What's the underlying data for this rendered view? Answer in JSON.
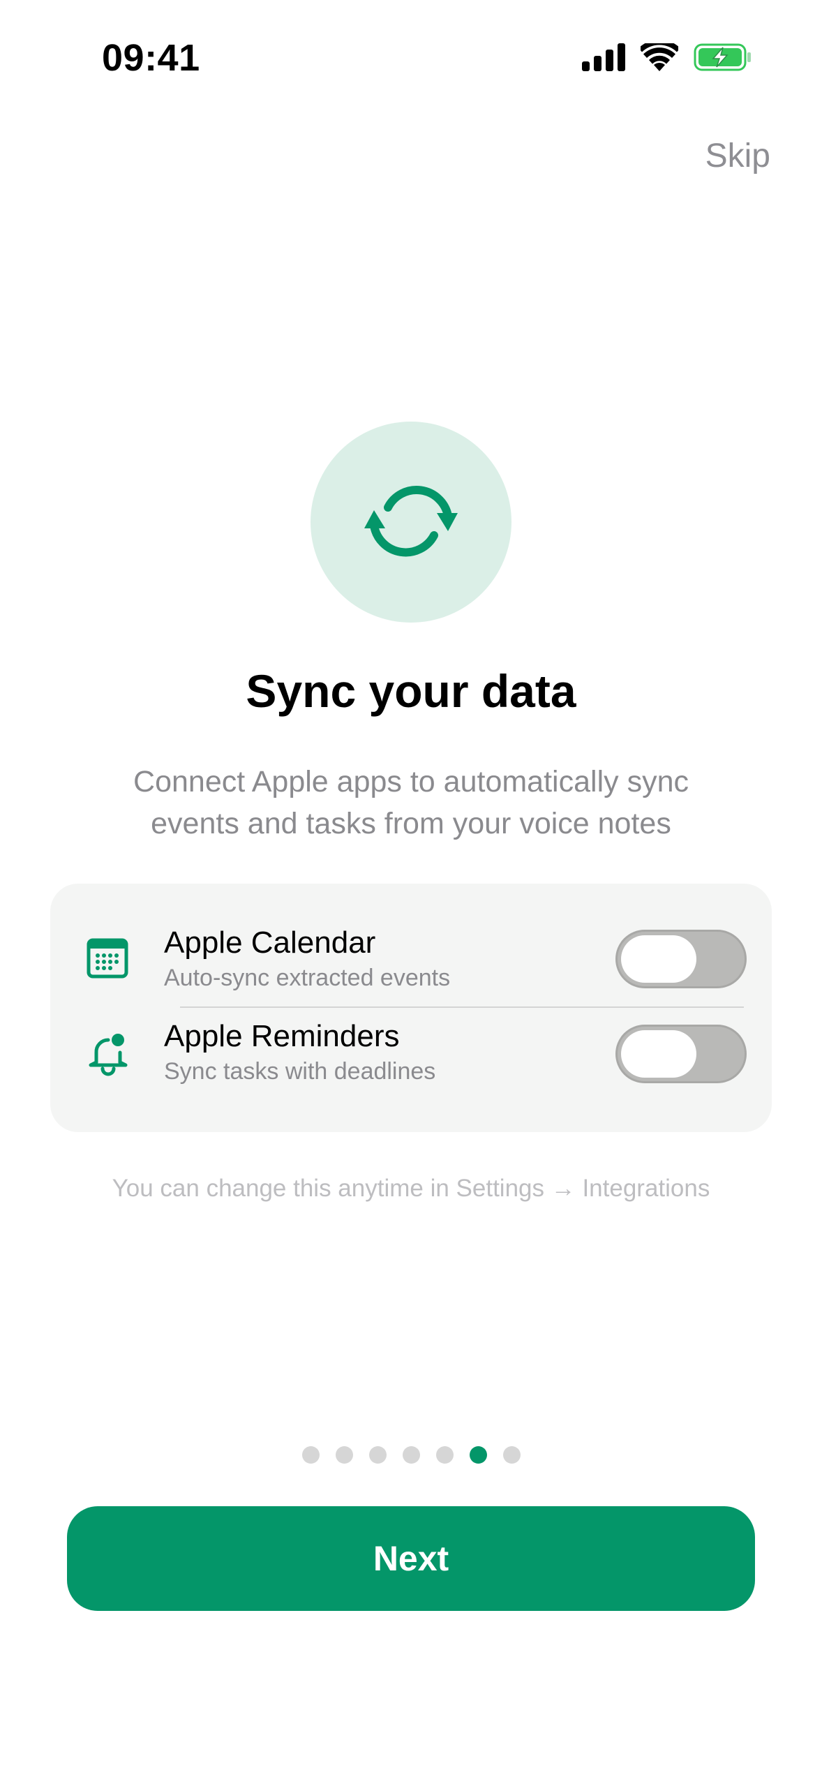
{
  "status_bar": {
    "time": "09:41",
    "icons": [
      "signal-icon",
      "wifi-icon",
      "battery-charging-icon"
    ],
    "battery_color": "#34c759"
  },
  "header": {
    "skip_label": "Skip"
  },
  "hero": {
    "icon": "sync-icon",
    "accent_color": "#049669",
    "circle_color": "#dbefe7",
    "title": "Sync your data",
    "subtitle_line1": "Connect Apple apps to automatically sync",
    "subtitle_line2": "events and tasks from your voice notes"
  },
  "integrations": [
    {
      "icon": "calendar-icon",
      "label": "Apple Calendar",
      "description": "Auto-sync extracted events",
      "enabled": false
    },
    {
      "icon": "bell-icon",
      "label": "Apple Reminders",
      "description": "Sync tasks with deadlines",
      "enabled": false
    }
  ],
  "hint": "You can change this anytime in Settings → Integrations",
  "pagination": {
    "total": 7,
    "current": 6
  },
  "footer": {
    "next_label": "Next"
  }
}
